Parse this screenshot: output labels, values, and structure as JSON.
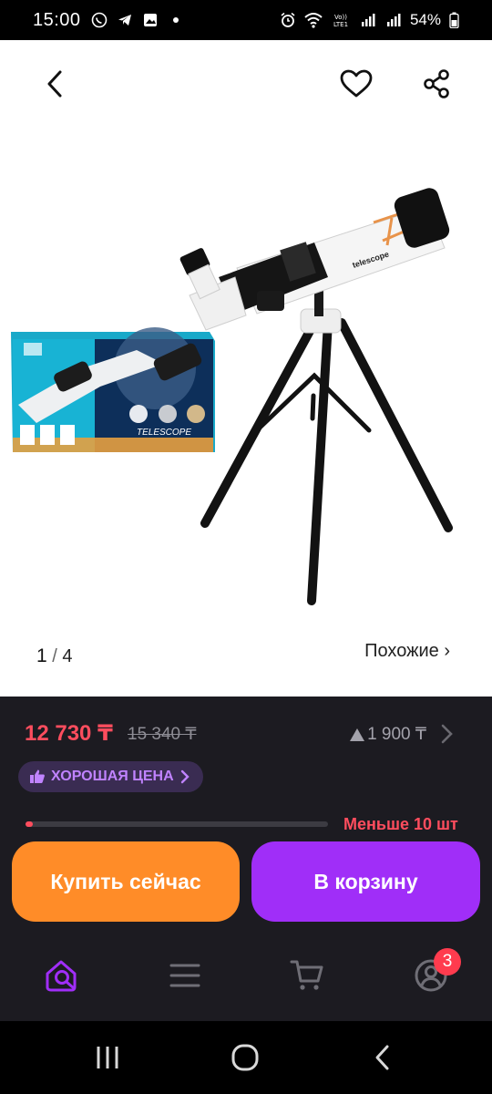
{
  "status_bar": {
    "time": "15:00",
    "left_icons": [
      "whatsapp-icon",
      "telegram-icon",
      "gallery-icon",
      "dot-icon"
    ],
    "right_icons": [
      "alarm-icon",
      "wifi-icon",
      "volte-icon",
      "signal-icon",
      "signal-icon",
      "battery-icon"
    ],
    "battery": "54%"
  },
  "header": {
    "back_icon": "chevron-left-icon",
    "favorite_icon": "heart-icon",
    "share_icon": "share-icon"
  },
  "gallery": {
    "current": "1",
    "separator": "/",
    "total": "4",
    "similar_label": "Похожие ›",
    "package_text": "TELESCOPE",
    "tube_label": "telescope"
  },
  "product": {
    "price": "12 730 ₸",
    "old_price": "15 340 ₸",
    "bonus": "1 900 ₸",
    "badge": "ХОРОШАЯ ЦЕНА",
    "stock_text": "Меньше 10 шт",
    "stock_level": 0.02
  },
  "actions": {
    "buy_now": "Купить сейчас",
    "add_to_cart": "В корзину"
  },
  "tabbar": {
    "items": [
      "home-search-icon",
      "catalog-icon",
      "cart-icon",
      "profile-icon"
    ],
    "profile_badge": "3"
  },
  "colors": {
    "price": "#ff4d5e",
    "buy": "#ff8c28",
    "cart": "#a02ef8",
    "badge_text": "#c083ff",
    "active_tab": "#a02ef8"
  }
}
